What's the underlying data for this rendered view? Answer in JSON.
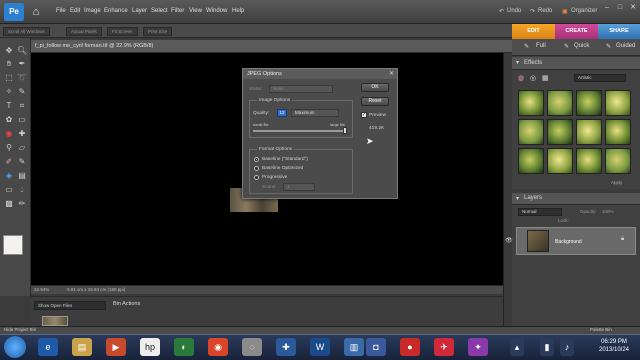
{
  "app": {
    "logo_text": "Pe"
  },
  "menu": {
    "items": [
      "File",
      "Edit",
      "Image",
      "Enhance",
      "Layer",
      "Select",
      "Filter",
      "View",
      "Window",
      "Help"
    ]
  },
  "topright": {
    "undo": "Undo",
    "redo": "Redo",
    "organizer": "Organizer"
  },
  "options_bar": {
    "buttons": [
      "Scroll All Windows",
      "Actual Pixels",
      "Fit Screen",
      "Print Size"
    ]
  },
  "mode_tabs": {
    "edit": "EDIT",
    "create": "CREATE",
    "share": "SHARE"
  },
  "edit_subtabs": {
    "full": "Full",
    "quick": "Quick",
    "guided": "Guided"
  },
  "document": {
    "tab_title": "f_pi_follow me_cyril forman.tif @ 22.9% (RGB/8)",
    "zoom": "22.94%",
    "size_info": "9.81 cm x 15.84 cm (180 ppi)"
  },
  "effects": {
    "title": "Effects",
    "dropdown": "Artistic",
    "apply": "Apply"
  },
  "layers": {
    "title": "Layers",
    "blend_mode": "Normal",
    "opacity_label": "Opacity:",
    "opacity_value": "100%",
    "lock_label": "Lock:",
    "layer_name": "Background"
  },
  "bin": {
    "select": "Show Open Files",
    "actions": "Bin Actions",
    "hide": "Hide Project Bin",
    "palette": "Palette Bin"
  },
  "dialog": {
    "title": "JPEG Options",
    "matte_label": "Matte:",
    "matte_value": "None",
    "ok": "OK",
    "reset": "Reset",
    "preview_label": "Preview",
    "file_size": "419.2K",
    "image_options": "Image Options",
    "quality_label": "Quality:",
    "quality_value": "12",
    "quality_level": "Maximum",
    "small_file": "small file",
    "large_file": "large file",
    "quality_fraction": 1.0,
    "format_options": "Format Options",
    "format_choices": [
      "Baseline (\"Standard\")",
      "Baseline Optimized",
      "Progressive"
    ],
    "selected_format": 0,
    "scans_label": "Scans:",
    "scans_value": "3"
  },
  "taskbar": {
    "time": "06:29 PM",
    "date": "2013/10/24"
  }
}
